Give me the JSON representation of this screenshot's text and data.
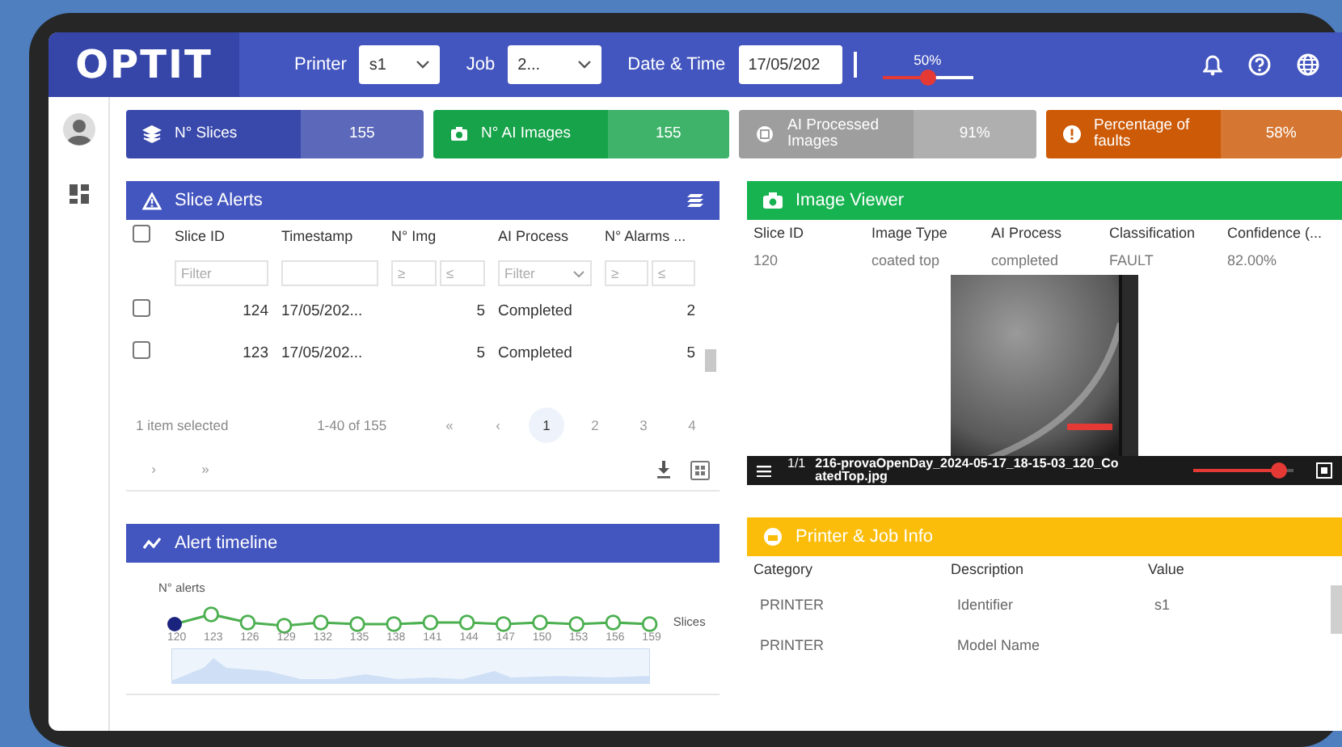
{
  "topbar": {
    "logo": "OPTIT",
    "filters": [
      {
        "kind": "select",
        "label": "Printer",
        "value": "s1"
      },
      {
        "kind": "select",
        "label": "Job",
        "value": "2..."
      },
      {
        "kind": "date",
        "label": "Date & Time",
        "value": "17/05/202"
      }
    ],
    "threshold": {
      "reading": "50%",
      "level": 0.5
    }
  },
  "stats": [
    {
      "kind": "layers",
      "label": "N° Slices",
      "value": "155",
      "color": "#3949ab"
    },
    {
      "kind": "camera",
      "label": "N° AI Images",
      "value": "155",
      "color": "#16a34a"
    },
    {
      "kind": "chip",
      "label": "AI Processed Images",
      "value": "91%",
      "color": "#9e9e9e"
    },
    {
      "kind": "alert",
      "label": "Percentage of faults",
      "value": "58%",
      "color": "#cc5a06"
    }
  ],
  "slice_alerts": {
    "title": "Slice Alerts",
    "header_checked": false,
    "columns": [
      "Slice ID",
      "Timestamp",
      "N° Img",
      "AI Process",
      "N° Alarms ..."
    ],
    "filters": [
      {
        "kind": "text",
        "placeholder": "Filter"
      },
      {
        "kind": "text"
      },
      {
        "kind": "range",
        "min_placeholder": "≥",
        "max_placeholder": "≤"
      },
      {
        "kind": "select",
        "placeholder": "Filter"
      },
      {
        "kind": "range",
        "min_placeholder": "≥",
        "max_placeholder": "≤"
      }
    ],
    "rows": [
      {
        "checked": false,
        "cells": [
          "124",
          "17/05/202...",
          "5",
          "Completed",
          "2"
        ]
      },
      {
        "checked": false,
        "cells": [
          "123",
          "17/05/202...",
          "5",
          "Completed",
          "5"
        ]
      }
    ],
    "selection": "1 item selected",
    "range": "1-40 of 155",
    "pages": [
      {
        "label": "«",
        "selected": false
      },
      {
        "label": "‹",
        "selected": false
      },
      {
        "label": "1",
        "selected": true
      },
      {
        "label": "2",
        "selected": false
      },
      {
        "label": "3",
        "selected": false
      },
      {
        "label": "4",
        "selected": false
      },
      {
        "label": "›",
        "selected": false
      },
      {
        "label": "»",
        "selected": false
      }
    ]
  },
  "alert_timeline": {
    "title": "Alert timeline",
    "y_label": "N° alerts",
    "x_label": "Slices",
    "ticks": [
      {
        "label": "120",
        "selected": true
      },
      {
        "label": "123",
        "selected": false
      },
      {
        "label": "126",
        "selected": false
      },
      {
        "label": "129",
        "selected": false
      },
      {
        "label": "132",
        "selected": false
      },
      {
        "label": "135",
        "selected": false
      },
      {
        "label": "138",
        "selected": false
      },
      {
        "label": "141",
        "selected": false
      },
      {
        "label": "144",
        "selected": false
      },
      {
        "label": "147",
        "selected": false
      },
      {
        "label": "150",
        "selected": false
      },
      {
        "label": "153",
        "selected": false
      },
      {
        "label": "156",
        "selected": false
      },
      {
        "label": "159",
        "selected": false
      }
    ]
  },
  "image_viewer": {
    "title": "Image Viewer",
    "columns": [
      "Slice ID",
      "Image Type",
      "AI Process",
      "Classification",
      "Confidence (..."
    ],
    "row": [
      "120",
      "coated top",
      "completed",
      "FAULT",
      "82.00%"
    ],
    "counter": "1/1",
    "filename": "216-provaOpenDay_2024-05-17_18-15-03_120_CoatedTop.jpg",
    "zoom": {
      "level": 0.85
    }
  },
  "printer_info": {
    "title": "Printer & Job Info",
    "columns": [
      "Category",
      "Description",
      "Value"
    ],
    "rows": [
      [
        "PRINTER",
        "Identifier",
        "s1"
      ],
      [
        "PRINTER",
        "Model Name"
      ]
    ]
  }
}
